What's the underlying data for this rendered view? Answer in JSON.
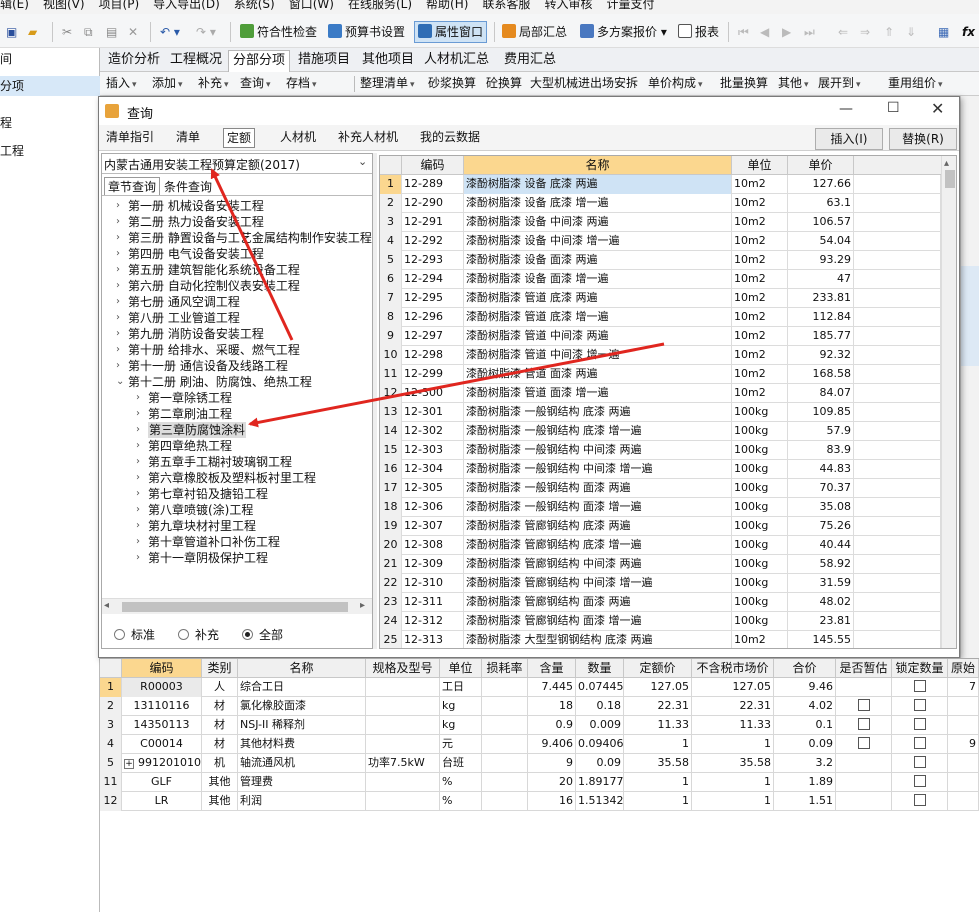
{
  "menubar": {
    "items": [
      "辑(E)",
      "视图(V)",
      "项目(P)",
      "导入导出(D)",
      "系统(S)",
      "窗口(W)",
      "在线服务(L)",
      "帮助(H)",
      "联系客服",
      "转入审核",
      "计量支付"
    ]
  },
  "toolbar1": {
    "items": [
      "符合性检查",
      "预算书设置",
      "属性窗口",
      "局部汇总",
      "多方案报价",
      "报表"
    ],
    "extra_icon": "fx"
  },
  "left_strip": {
    "items": [
      "间",
      "分项",
      "程",
      "工程"
    ]
  },
  "tabs2": {
    "items": [
      "造价分析",
      "工程概况",
      "分部分项",
      "措施项目",
      "其他项目",
      "人材机汇总",
      "费用汇总"
    ],
    "active": 2
  },
  "toolbar2": {
    "items": [
      "插入",
      "添加",
      "补充",
      "查询",
      "存档",
      "整理清单",
      "砂浆换算",
      "砼换算",
      "大型机械进出场安拆",
      "单价构成",
      "批量换算",
      "其他",
      "展开到",
      "重用组价"
    ]
  },
  "dialog": {
    "title": "查询",
    "tabs": [
      "清单指引",
      "清单",
      "定额",
      "人材机",
      "补充人材机",
      "我的云数据"
    ],
    "active_tab": 2,
    "insert_label": "插入(I)",
    "replace_label": "替换(R)",
    "quota_select": "内蒙古通用安装工程预算定额(2017)",
    "sub_tabs": [
      "章节查询",
      "条件查询"
    ],
    "tree": [
      {
        "label": "第一册 机械设备安装工程",
        "level": 0,
        "expanded": false
      },
      {
        "label": "第二册 热力设备安装工程",
        "level": 0,
        "expanded": false
      },
      {
        "label": "第三册 静置设备与工艺金属结构制作安装工程",
        "level": 0,
        "expanded": false
      },
      {
        "label": "第四册 电气设备安装工程",
        "level": 0,
        "expanded": false
      },
      {
        "label": "第五册 建筑智能化系统设备工程",
        "level": 0,
        "expanded": false
      },
      {
        "label": "第六册 自动化控制仪表安装工程",
        "level": 0,
        "expanded": false
      },
      {
        "label": "第七册 通风空调工程",
        "level": 0,
        "expanded": false
      },
      {
        "label": "第八册 工业管道工程",
        "level": 0,
        "expanded": false
      },
      {
        "label": "第九册 消防设备安装工程",
        "level": 0,
        "expanded": false
      },
      {
        "label": "第十册 给排水、采暖、燃气工程",
        "level": 0,
        "expanded": false
      },
      {
        "label": "第十一册 通信设备及线路工程",
        "level": 0,
        "expanded": false
      },
      {
        "label": "第十二册 刷油、防腐蚀、绝热工程",
        "level": 0,
        "expanded": true
      },
      {
        "label": "第一章除锈工程",
        "level": 1,
        "expanded": false
      },
      {
        "label": "第二章刷油工程",
        "level": 1,
        "expanded": false
      },
      {
        "label": "第三章防腐蚀涂料",
        "level": 1,
        "expanded": false,
        "selected": true
      },
      {
        "label": "第四章绝热工程",
        "level": 1,
        "expanded": false
      },
      {
        "label": "第五章手工糊衬玻璃钢工程",
        "level": 1,
        "expanded": false
      },
      {
        "label": "第六章橡胶板及塑料板衬里工程",
        "level": 1,
        "expanded": false
      },
      {
        "label": "第七章衬铅及搪铅工程",
        "level": 1,
        "expanded": false
      },
      {
        "label": "第八章喷镀(涂)工程",
        "level": 1,
        "expanded": false
      },
      {
        "label": "第九章块材衬里工程",
        "level": 1,
        "expanded": false
      },
      {
        "label": "第十章管道补口补伤工程",
        "level": 1,
        "expanded": false
      },
      {
        "label": "第十一章阴极保护工程",
        "level": 1,
        "expanded": false
      }
    ],
    "radios": [
      "标准",
      "补充",
      "全部"
    ],
    "radio_selected": 2,
    "grid_headers": [
      "",
      "编码",
      "名称",
      "单位",
      "单价"
    ],
    "grid_rows": [
      [
        "1",
        "12-289",
        "漆酚树脂漆 设备 底漆 两遍",
        "10m2",
        "127.66"
      ],
      [
        "2",
        "12-290",
        "漆酚树脂漆 设备 底漆 增一遍",
        "10m2",
        "63.1"
      ],
      [
        "3",
        "12-291",
        "漆酚树脂漆 设备 中间漆 两遍",
        "10m2",
        "106.57"
      ],
      [
        "4",
        "12-292",
        "漆酚树脂漆 设备 中间漆 增一遍",
        "10m2",
        "54.04"
      ],
      [
        "5",
        "12-293",
        "漆酚树脂漆 设备 面漆 两遍",
        "10m2",
        "93.29"
      ],
      [
        "6",
        "12-294",
        "漆酚树脂漆 设备 面漆 增一遍",
        "10m2",
        "47"
      ],
      [
        "7",
        "12-295",
        "漆酚树脂漆 管道 底漆 两遍",
        "10m2",
        "233.81"
      ],
      [
        "8",
        "12-296",
        "漆酚树脂漆 管道 底漆 增一遍",
        "10m2",
        "112.84"
      ],
      [
        "9",
        "12-297",
        "漆酚树脂漆 管道 中间漆 两遍",
        "10m2",
        "185.77"
      ],
      [
        "10",
        "12-298",
        "漆酚树脂漆 管道 中间漆 增一遍",
        "10m2",
        "92.32"
      ],
      [
        "11",
        "12-299",
        "漆酚树脂漆 管道 面漆 两遍",
        "10m2",
        "168.58"
      ],
      [
        "12",
        "12-300",
        "漆酚树脂漆 管道 面漆 增一遍",
        "10m2",
        "84.07"
      ],
      [
        "13",
        "12-301",
        "漆酚树脂漆 一般钢结构 底漆 两遍",
        "100kg",
        "109.85"
      ],
      [
        "14",
        "12-302",
        "漆酚树脂漆 一般钢结构 底漆 增一遍",
        "100kg",
        "57.9"
      ],
      [
        "15",
        "12-303",
        "漆酚树脂漆 一般钢结构 中间漆 两遍",
        "100kg",
        "83.9"
      ],
      [
        "16",
        "12-304",
        "漆酚树脂漆 一般钢结构 中间漆 增一遍",
        "100kg",
        "44.83"
      ],
      [
        "17",
        "12-305",
        "漆酚树脂漆 一般钢结构 面漆 两遍",
        "100kg",
        "70.37"
      ],
      [
        "18",
        "12-306",
        "漆酚树脂漆 一般钢结构 面漆 增一遍",
        "100kg",
        "35.08"
      ],
      [
        "19",
        "12-307",
        "漆酚树脂漆 管廊钢结构 底漆 两遍",
        "100kg",
        "75.26"
      ],
      [
        "20",
        "12-308",
        "漆酚树脂漆 管廊钢结构 底漆 增一遍",
        "100kg",
        "40.44"
      ],
      [
        "21",
        "12-309",
        "漆酚树脂漆 管廊钢结构 中间漆 两遍",
        "100kg",
        "58.92"
      ],
      [
        "22",
        "12-310",
        "漆酚树脂漆 管廊钢结构 中间漆 增一遍",
        "100kg",
        "31.59"
      ],
      [
        "23",
        "12-311",
        "漆酚树脂漆 管廊钢结构 面漆 两遍",
        "100kg",
        "48.02"
      ],
      [
        "24",
        "12-312",
        "漆酚树脂漆 管廊钢结构 面漆 增一遍",
        "100kg",
        "23.81"
      ],
      [
        "25",
        "12-313",
        "漆酚树脂漆 大型型钢钢结构 底漆 两遍",
        "10m2",
        "145.55"
      ]
    ]
  },
  "bottom": {
    "headers": [
      "",
      "编码",
      "类别",
      "名称",
      "规格及型号",
      "单位",
      "损耗率",
      "含量",
      "数量",
      "定额价",
      "不含税市场价",
      "合价",
      "是否暂估",
      "锁定数量",
      "原始"
    ],
    "rows": [
      {
        "no": "1",
        "code": "R00003",
        "type": "人",
        "name": "综合工日",
        "spec": "",
        "unit": "工日",
        "loss": "",
        "content": "7.445",
        "qty": "0.07445",
        "price": "127.05",
        "market": "127.05",
        "total": "9.46",
        "est": false,
        "lock": true,
        "orig": "7"
      },
      {
        "no": "2",
        "code": "13110116",
        "type": "材",
        "name": "氯化橡胶面漆",
        "spec": "",
        "unit": "kg",
        "loss": "",
        "content": "18",
        "qty": "0.18",
        "price": "22.31",
        "market": "22.31",
        "total": "4.02",
        "est": true,
        "lock": true,
        "orig": ""
      },
      {
        "no": "3",
        "code": "14350113",
        "type": "材",
        "name": "NSJ-II 稀释剂",
        "spec": "",
        "unit": "kg",
        "loss": "",
        "content": "0.9",
        "qty": "0.009",
        "price": "11.33",
        "market": "11.33",
        "total": "0.1",
        "est": true,
        "lock": true,
        "orig": ""
      },
      {
        "no": "4",
        "code": "C00014",
        "type": "材",
        "name": "其他材料费",
        "spec": "",
        "unit": "元",
        "loss": "",
        "content": "9.406",
        "qty": "0.09406",
        "price": "1",
        "market": "1",
        "total": "0.09",
        "est": true,
        "lock": true,
        "orig": "9"
      },
      {
        "no": "5",
        "code": "991201010",
        "type": "机",
        "name": "轴流通风机",
        "spec": "功率7.5kW",
        "unit": "台班",
        "loss": "",
        "content": "9",
        "qty": "0.09",
        "price": "35.58",
        "market": "35.58",
        "total": "3.2",
        "est": false,
        "lock": true,
        "orig": "",
        "expand": "+"
      },
      {
        "no": "11",
        "code": "GLF",
        "type": "其他",
        "name": "管理费",
        "spec": "",
        "unit": "%",
        "loss": "",
        "content": "20",
        "qty": "1.89177",
        "price": "1",
        "market": "1",
        "total": "1.89",
        "est": false,
        "lock": true,
        "orig": ""
      },
      {
        "no": "12",
        "code": "LR",
        "type": "其他",
        "name": "利润",
        "spec": "",
        "unit": "%",
        "loss": "",
        "content": "16",
        "qty": "1.51342",
        "price": "1",
        "market": "1",
        "total": "1.51",
        "est": false,
        "lock": true,
        "orig": ""
      }
    ]
  },
  "colors": {
    "accent": "#fbd78f",
    "arrow": "#e0261f",
    "selected_row": "#cfe3f5"
  }
}
